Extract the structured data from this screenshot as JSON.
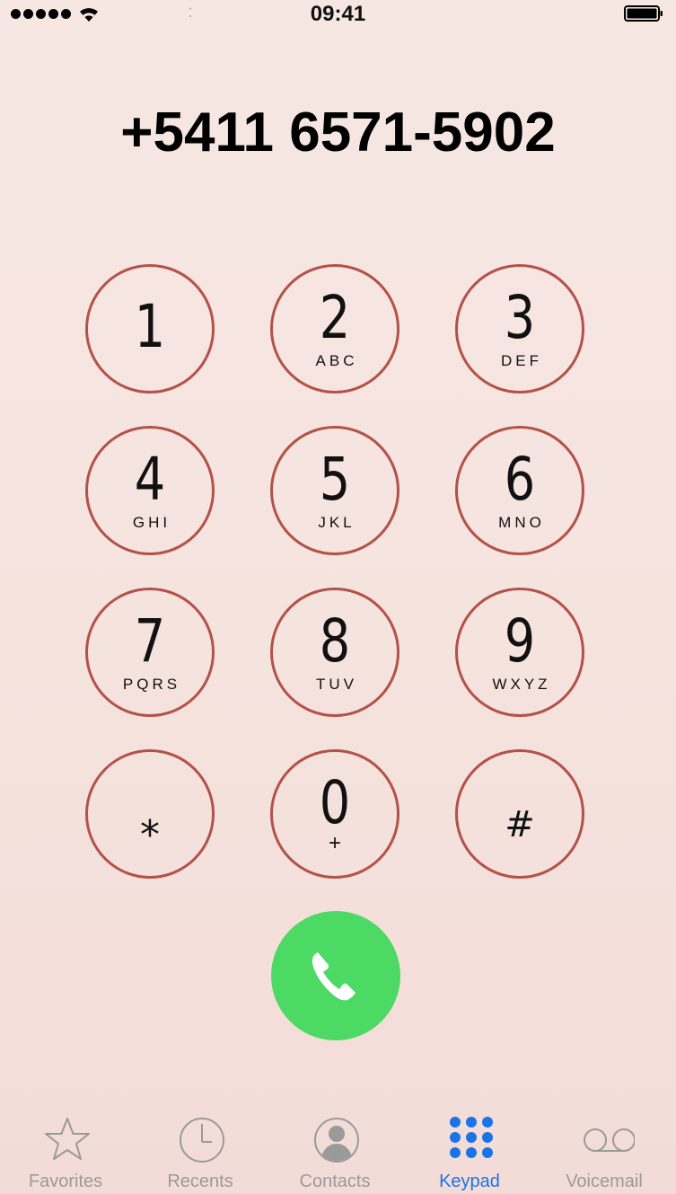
{
  "status_bar": {
    "time": "09:41",
    "signal_bars": 5,
    "wifi_icon": "wifi-icon",
    "battery_icon": "battery-full-icon"
  },
  "dialer": {
    "number": "+5411 6571-5902"
  },
  "keypad": {
    "keys": [
      {
        "digit": "1",
        "letters": ""
      },
      {
        "digit": "2",
        "letters": "ABC"
      },
      {
        "digit": "3",
        "letters": "DEF"
      },
      {
        "digit": "4",
        "letters": "GHI"
      },
      {
        "digit": "5",
        "letters": "JKL"
      },
      {
        "digit": "6",
        "letters": "MNO"
      },
      {
        "digit": "7",
        "letters": "PQRS"
      },
      {
        "digit": "8",
        "letters": "TUV"
      },
      {
        "digit": "9",
        "letters": "WXYZ"
      },
      {
        "digit": "⁎",
        "letters": ""
      },
      {
        "digit": "0",
        "letters": "+"
      },
      {
        "digit": "#",
        "letters": ""
      }
    ],
    "ring_color": "#b35248",
    "call_button_color": "#4cd964",
    "call_icon": "phone-icon"
  },
  "tab_bar": {
    "active_color": "#1a73e8",
    "inactive_color": "#9a9a9a",
    "tabs": [
      {
        "label": "Favorites",
        "icon": "star-icon",
        "active": false
      },
      {
        "label": "Recents",
        "icon": "clock-icon",
        "active": false
      },
      {
        "label": "Contacts",
        "icon": "contacts-icon",
        "active": false
      },
      {
        "label": "Keypad",
        "icon": "keypad-icon",
        "active": true
      },
      {
        "label": "Voicemail",
        "icon": "voicemail-icon",
        "active": false
      }
    ]
  }
}
